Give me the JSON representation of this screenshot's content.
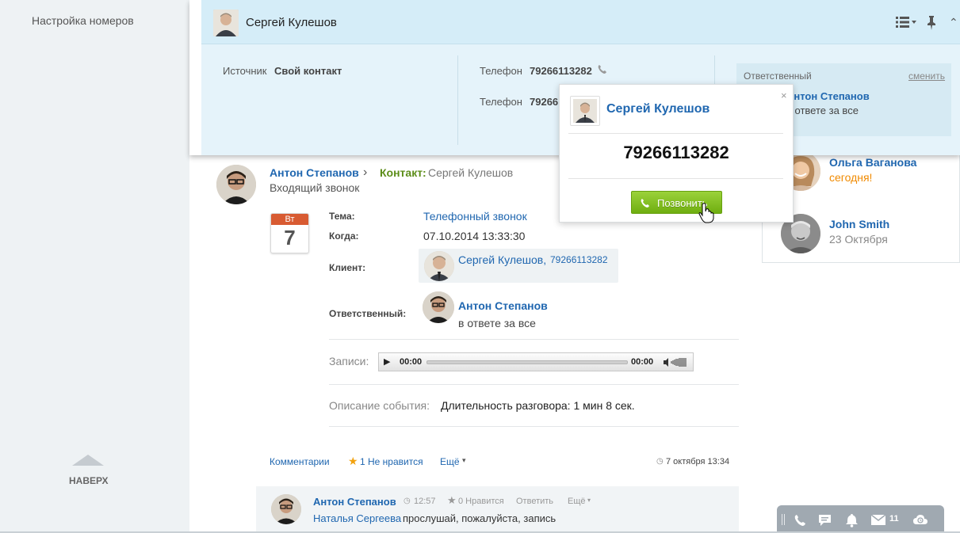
{
  "sidebar": {
    "nav_item": "Настройка номеров",
    "back_to_top": "НАВЕРХ"
  },
  "contact_card": {
    "name": "Сергей Кулешов",
    "source_label": "Источник",
    "source_value": "Свой контакт",
    "phones": [
      {
        "label": "Телефон",
        "value": "79266113282"
      },
      {
        "label": "Телефон",
        "value": "79266"
      }
    ],
    "responsible_label": "Ответственный",
    "responsible_change": "сменить",
    "responsible_name": "Антон Степанов",
    "responsible_sub": "в ответе за все",
    "icons": {
      "list": "list-view-icon",
      "pin": "pin-icon",
      "collapse": "chevron-up-icon"
    }
  },
  "call_popup": {
    "close": "×",
    "name": "Сергей Кулешов",
    "number": "79266113282",
    "call_button": "Позвонить"
  },
  "post": {
    "author": "Антон Степанов",
    "arrow": "›",
    "contact_label": "Контакт:",
    "contact_name": "Сергей Кулешов",
    "event_type": "Входящий звонок",
    "calendar": {
      "weekday": "Вт",
      "day": "7"
    },
    "fields": {
      "topic_label": "Тема:",
      "topic_value": "Телефонный звонок",
      "when_label": "Когда:",
      "when_value": "07.10.2014 13:33:30",
      "client_label": "Клиент:",
      "client_name": "Сергей Кулешов,",
      "client_phone": "79266113282",
      "responsible_label": "Ответственный:",
      "responsible_name": "Антон Степанов",
      "responsible_sub": "в ответе за все"
    },
    "records_label": "Записи:",
    "player": {
      "play": "▶",
      "start": "00:00",
      "end": "00:00",
      "progress": 0
    },
    "description_label": "Описание события:",
    "description_value": "Длительность разговора: 1 мин 8 сек.",
    "actions": {
      "comments": "Комментарии",
      "star": "★",
      "like_count": "1",
      "dislike": "Не нравится",
      "more": "Ещё",
      "caret": "▾",
      "clock": "◷",
      "date": "7 октября 13:34"
    }
  },
  "comment": {
    "author": "Антон Степанов",
    "clock": "◷",
    "time": "12:57",
    "star": "★",
    "likes": "0 Нравится",
    "reply": "Ответить",
    "more": "Ещё",
    "caret": "▾",
    "mention": "Наталья Сергеева",
    "text": "прослушай, пожалуйста, запись"
  },
  "people": [
    {
      "name": "Ольга Ваганова",
      "when": "сегодня!"
    },
    {
      "name": "John Smith",
      "when": "23 Октября"
    }
  ],
  "toolbar": {
    "icons": [
      "phone-icon",
      "chat-icon",
      "bell-icon",
      "mail-icon",
      "cloud-icon"
    ],
    "mail_count": "11"
  },
  "colors": {
    "link": "#2067b0",
    "contact_green": "#5c8d19",
    "accent_orange": "#f08a00",
    "card_bg": "#e5f3fa",
    "call_green": "#7cbc1a"
  }
}
